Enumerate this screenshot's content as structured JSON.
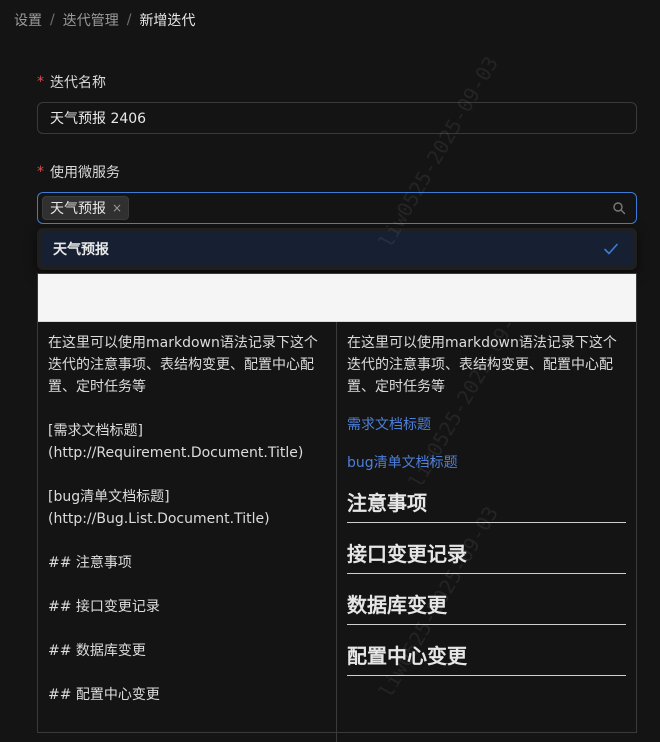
{
  "breadcrumb": {
    "items": [
      "设置",
      "迭代管理",
      "新增迭代"
    ],
    "separator": "/"
  },
  "form": {
    "iteration_name": {
      "required_mark": "*",
      "label": "迭代名称",
      "value": "天气预报 2406"
    },
    "microservices": {
      "required_mark": "*",
      "label": "使用微服务",
      "selected_tag": "天气预报",
      "tag_close": "×"
    },
    "dropdown": {
      "option_label": "天气预报",
      "option_selected": true
    }
  },
  "editor": {
    "source": [
      "在这里可以使用markdown语法记录下这个迭代的注意事项、表结构变更、配置中心配置、定时任务等",
      "[需求文档标题]\n(http://Requirement.Document.Title)",
      "[bug清单文档标题]\n(http://Bug.List.Document.Title)",
      "## 注意事项",
      "## 接口变更记录",
      "## 数据库变更",
      "## 配置中心变更"
    ],
    "preview": {
      "intro": "在这里可以使用markdown语法记录下这个迭代的注意事项、表结构变更、配置中心配置、定时任务等",
      "links": [
        "需求文档标题",
        "bug清单文档标题"
      ],
      "headings": [
        "注意事项",
        "接口变更记录",
        "数据库变更",
        "配置中心变更"
      ]
    }
  },
  "watermark": {
    "text": "liw0525-2025-09-03"
  },
  "colors": {
    "accent": "#3d7bd6",
    "link": "#4d7fd8",
    "required": "#e84a4a",
    "background": "#141414"
  }
}
